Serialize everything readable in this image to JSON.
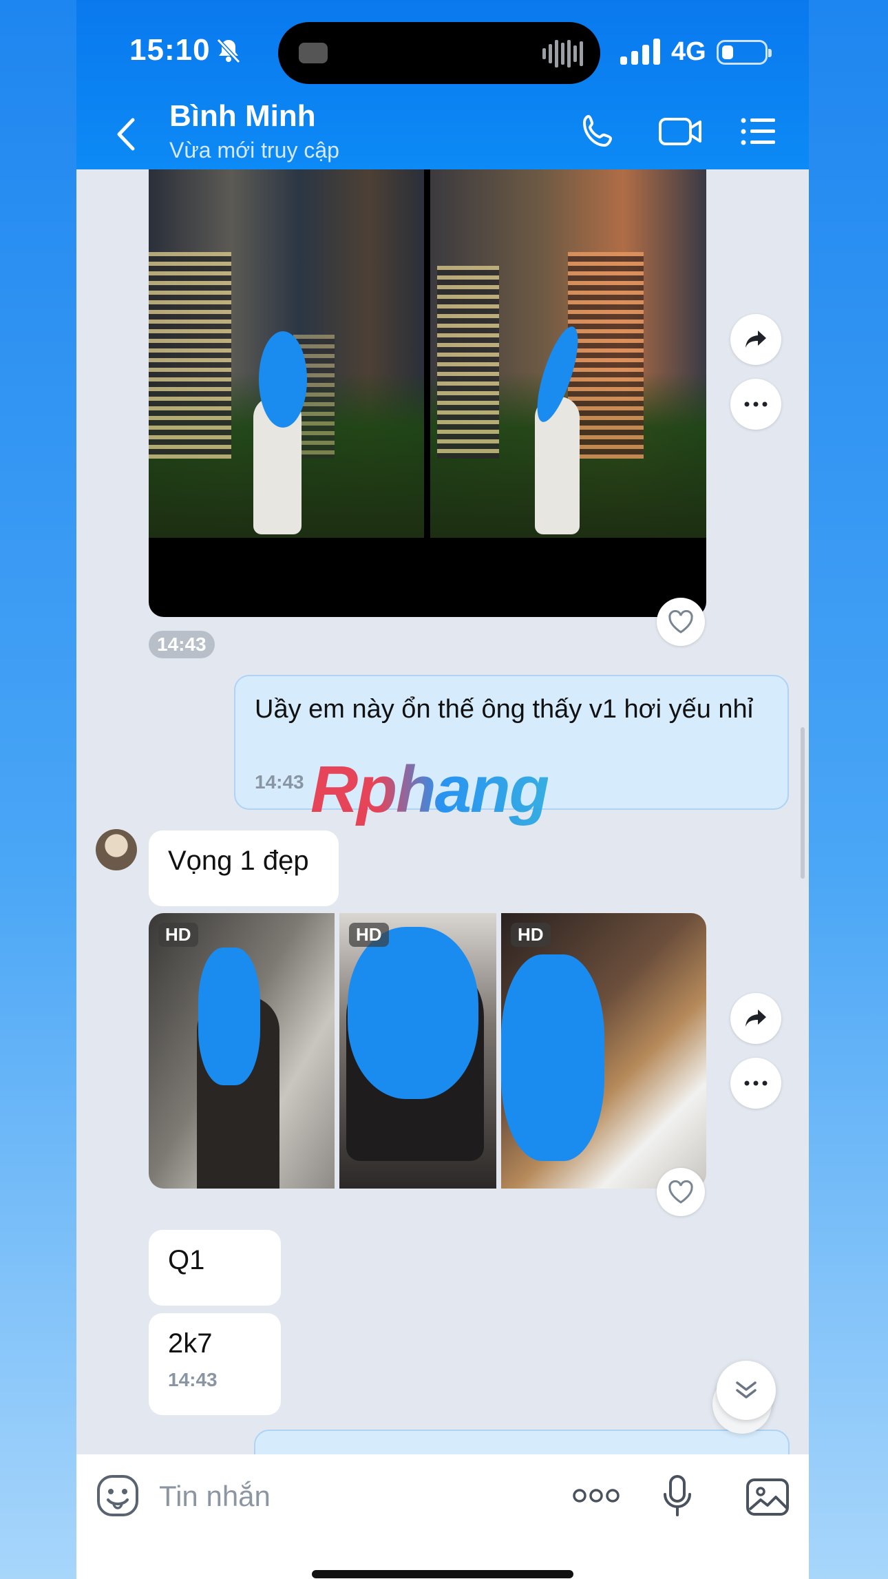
{
  "status_bar": {
    "time": "15:10",
    "network": "4G"
  },
  "header": {
    "contact_name": "Bình Minh",
    "contact_status": "Vừa mới truy cập"
  },
  "messages": {
    "photo_pair_time": "14:43",
    "outgoing_text": "Uầy em này ổn thế ông thấy v1 hơi yếu nhỉ",
    "outgoing_time": "14:43",
    "incoming_1": "Vọng 1 đẹp",
    "hd_badges": [
      "HD",
      "HD",
      "HD"
    ],
    "incoming_2": "Q1",
    "incoming_3": "2k7",
    "incoming_3_time": "14:43"
  },
  "watermark": "Rphang",
  "composer": {
    "placeholder": "Tin nhắn"
  },
  "icons": [
    "back-icon",
    "call-icon",
    "video-call-icon",
    "menu-icon",
    "forward-icon",
    "more-icon",
    "heart-icon",
    "emoji-icon",
    "mic-icon",
    "image-icon",
    "chevron-double-down-icon"
  ],
  "colors": {
    "header": "#0c8af5",
    "chat_bg": "#e3e8f0",
    "outgoing_bubble": "#d6ecfd",
    "accent": "#1a8cf0"
  }
}
